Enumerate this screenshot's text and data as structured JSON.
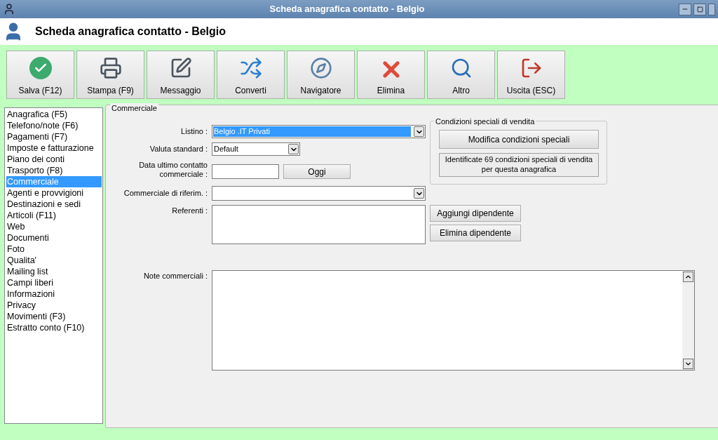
{
  "window": {
    "title": "Scheda anagrafica contatto - Belgio"
  },
  "header": {
    "title": "Scheda anagrafica contatto - Belgio"
  },
  "toolbar": [
    {
      "kind": "save",
      "label": "Salva (F12)"
    },
    {
      "kind": "print",
      "label": "Stampa (F9)"
    },
    {
      "kind": "message",
      "label": "Messaggio"
    },
    {
      "kind": "convert",
      "label": "Converti"
    },
    {
      "kind": "navigator",
      "label": "Navigatore"
    },
    {
      "kind": "delete",
      "label": "Elimina"
    },
    {
      "kind": "more",
      "label": "Altro"
    },
    {
      "kind": "exit",
      "label": "Uscita (ESC)"
    }
  ],
  "sidebar": {
    "items": [
      {
        "label": "Anagrafica (F5)",
        "selected": false
      },
      {
        "label": "Telefono/note (F6)",
        "selected": false
      },
      {
        "label": "Pagamenti (F7)",
        "selected": false
      },
      {
        "label": "Imposte e fatturazione",
        "selected": false
      },
      {
        "label": "Piano dei conti",
        "selected": false
      },
      {
        "label": "Trasporto (F8)",
        "selected": false
      },
      {
        "label": "Commerciale",
        "selected": true
      },
      {
        "label": "Agenti e provvigioni",
        "selected": false
      },
      {
        "label": "Destinazioni e sedi",
        "selected": false
      },
      {
        "label": "Articoli (F11)",
        "selected": false
      },
      {
        "label": "Web",
        "selected": false
      },
      {
        "label": "Documenti",
        "selected": false
      },
      {
        "label": "Foto",
        "selected": false
      },
      {
        "label": "Qualita'",
        "selected": false
      },
      {
        "label": "Mailing list",
        "selected": false
      },
      {
        "label": "Campi liberi",
        "selected": false
      },
      {
        "label": "Informazioni",
        "selected": false
      },
      {
        "label": "Privacy",
        "selected": false
      },
      {
        "label": "Movimenti (F3)",
        "selected": false
      },
      {
        "label": "Estratto conto (F10)",
        "selected": false
      }
    ]
  },
  "panel": {
    "legend": "Commerciale",
    "listino": {
      "label": "Listino :",
      "value": "Belgio .IT Privati",
      "highlighted": true
    },
    "valuta": {
      "label": "Valuta standard :",
      "value": "Default"
    },
    "data_contatto": {
      "label": "Data ultimo contatto commerciale :",
      "button": "Oggi"
    },
    "commerciale_riferimento": {
      "label": "Commerciale di riferim. :"
    },
    "referenti": {
      "label": "Referenti :",
      "buttons": [
        "Aggiungi dipendente",
        "Elimina dipendente"
      ]
    },
    "condizioni": {
      "legend": "Condizioni speciali di vendita",
      "button": "Modifica condizioni speciali",
      "info": "Identificate 69 condizioni speciali di vendita per questa anagrafica"
    },
    "note": {
      "label": "Note commerciali :"
    }
  }
}
